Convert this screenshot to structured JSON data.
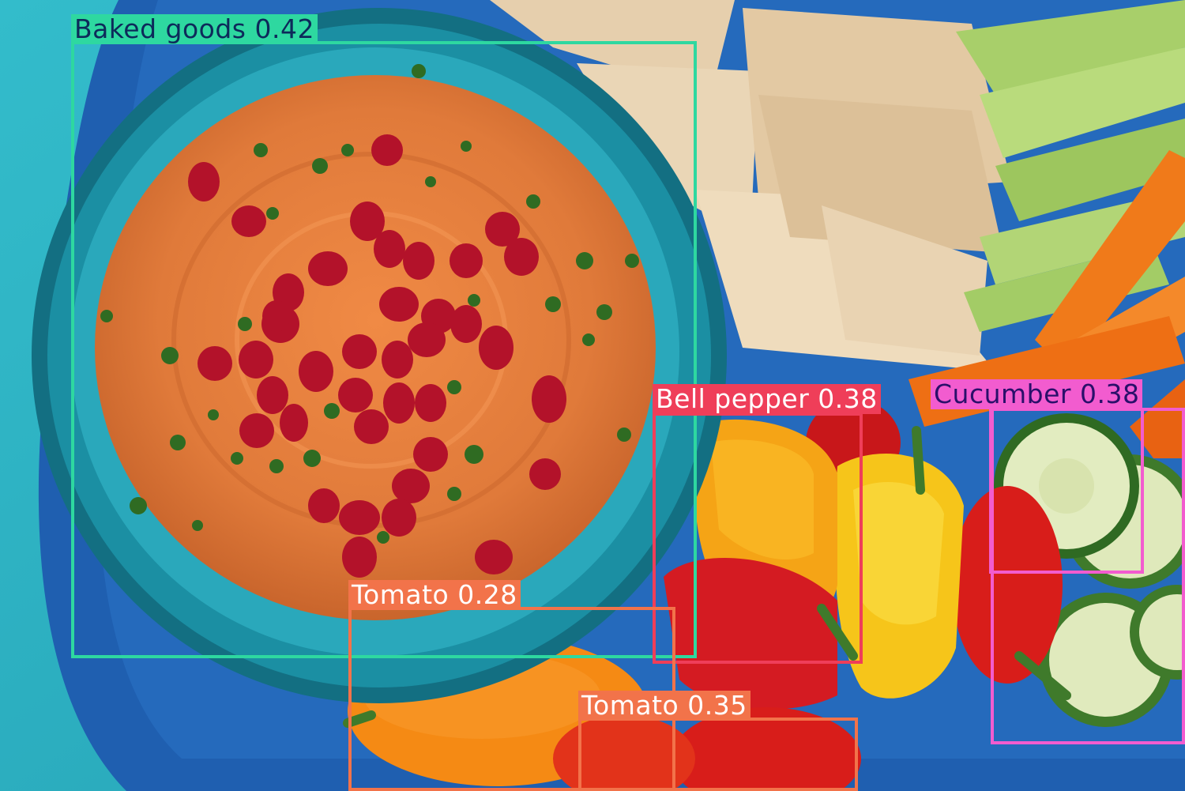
{
  "image": {
    "subject": "hummus bowl with crudites and pita",
    "palette": {
      "table": "#2fb3c4",
      "platter": "#1f5fb0",
      "bowl": "#1b8fa3",
      "dip": "#e07a3a",
      "pomegranate": "#b3122a",
      "pita": "#e8d2b0",
      "celery": "#a8cf6a",
      "carrot": "#f07a1a",
      "cucumber_flesh": "#e2ecc0",
      "cucumber_skin": "#3f7a2b",
      "pepper_yellow": "#f6c51a",
      "pepper_orange": "#f58a14",
      "pepper_red": "#d81d1a"
    }
  },
  "detections": [
    {
      "label": "Baked goods 0.42",
      "color": "#2ed8a0",
      "text_color": "#0d2a5a"
    },
    {
      "label": "Bell pepper 0.38",
      "color": "#ef3e59",
      "text_color": "#ffffff"
    },
    {
      "label": "Cucumber 0.38",
      "color": "#f25ccf",
      "text_color": "#2a0f6a"
    },
    {
      "label": "Tomato 0.28",
      "color": "#f2734a",
      "text_color": "#ffffff"
    },
    {
      "label": "Tomato 0.35",
      "color": "#f2734a",
      "text_color": "#ffffff"
    }
  ]
}
